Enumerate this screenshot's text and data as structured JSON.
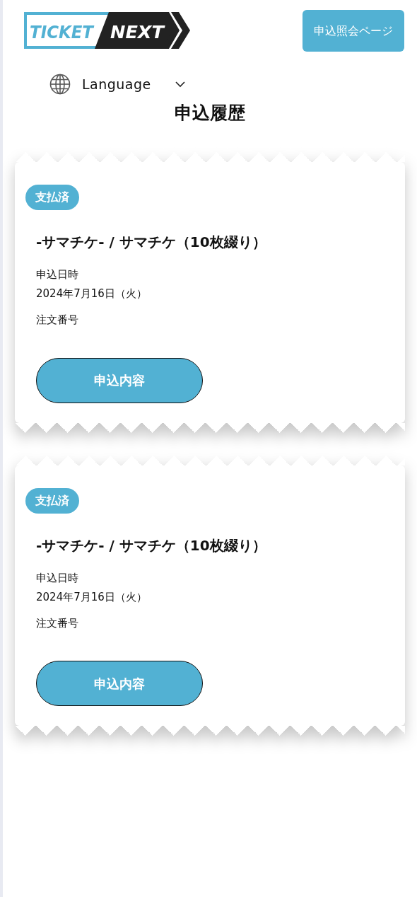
{
  "header": {
    "logo": [
      "TICKET",
      "NEXT"
    ],
    "lookup_button": "申込照会ページ"
  },
  "language": {
    "label": "Language"
  },
  "title": "申込履歴",
  "orders": [
    {
      "status": "支払済",
      "name": "-サマチケ- / サマチケ（10枚綴り）",
      "date_label": "申込日時",
      "date": "2024年7月16日（火）",
      "order_label": "注文番号",
      "button": "申込内容"
    },
    {
      "status": "支払済",
      "name": "-サマチケ- / サマチケ（10枚綴り）",
      "date_label": "申込日時",
      "date": "2024年7月16日（火）",
      "order_label": "注文番号",
      "button": "申込内容"
    }
  ]
}
